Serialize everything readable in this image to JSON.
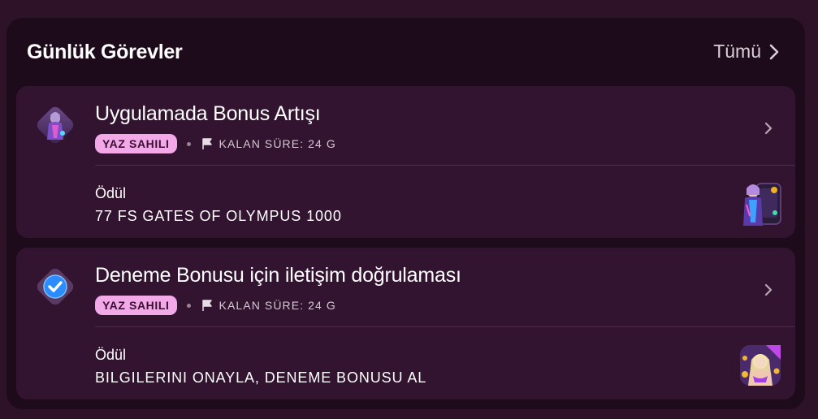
{
  "header": {
    "title": "Günlük Görevler",
    "see_all_label": "Tümü"
  },
  "tasks": [
    {
      "title": "Uygulamada Bonus Artışı",
      "badge": "YAZ SAHILI",
      "remaining": "KALAN SÜRE: 24 G",
      "reward_label": "Ödül",
      "reward_value": "77 FS GATES OF OLYMPUS 1000",
      "icon": "character-art-icon",
      "reward_image": "game-thumbnail-icon"
    },
    {
      "title": "Deneme Bonusu için iletişim doğrulaması",
      "badge": "YAZ SAHILI",
      "remaining": "KALAN SÜRE: 24 G",
      "reward_label": "Ödül",
      "reward_value": "BILGILERINI ONAYLA, DENEME BONUSU AL",
      "icon": "verified-check-icon",
      "reward_image": "bonus-thumbnail-icon"
    }
  ],
  "colors": {
    "page_bg": "#2d1228",
    "panel_bg": "#1d0a1a",
    "card_bg": "#321430",
    "badge_bg": "#f3a9e8",
    "badge_text": "#3a0f33",
    "check_blue": "#2a8cff"
  }
}
